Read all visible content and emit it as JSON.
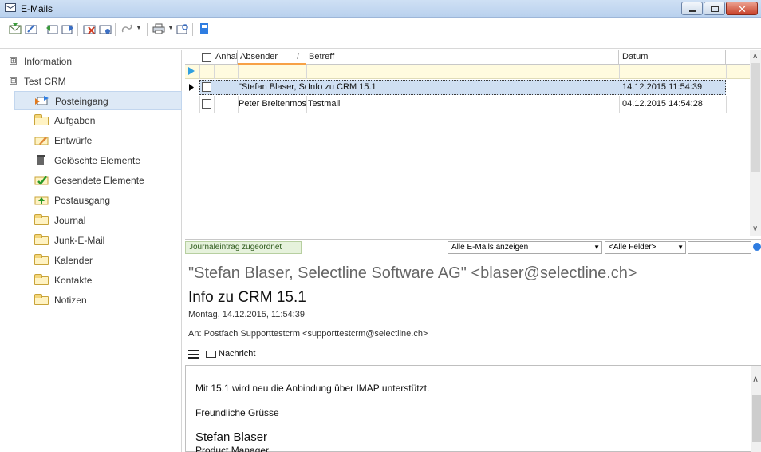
{
  "window": {
    "title": "E-Mails"
  },
  "nav": {
    "groups": [
      {
        "label": "Information",
        "expander": "⊞"
      },
      {
        "label": "Test CRM",
        "expander": "⊟"
      }
    ],
    "items": [
      {
        "label": "Posteingang",
        "icon": "inbox-icon"
      },
      {
        "label": "Aufgaben",
        "icon": "folder-icon"
      },
      {
        "label": "Entwürfe",
        "icon": "drafts-icon"
      },
      {
        "label": "Gelöschte Elemente",
        "icon": "trash-icon"
      },
      {
        "label": "Gesendete Elemente",
        "icon": "sent-icon"
      },
      {
        "label": "Postausgang",
        "icon": "outbox-icon"
      },
      {
        "label": "Journal",
        "icon": "folder-icon"
      },
      {
        "label": "Junk-E-Mail",
        "icon": "folder-icon"
      },
      {
        "label": "Kalender",
        "icon": "folder-icon"
      },
      {
        "label": "Kontakte",
        "icon": "folder-icon"
      },
      {
        "label": "Notizen",
        "icon": "folder-icon"
      }
    ]
  },
  "grid": {
    "columns": {
      "attach": "Anhai",
      "sender": "Absender",
      "sort_mark": "/",
      "subject": "Betreff",
      "date": "Datum"
    },
    "rows": [
      {
        "sender": "\"Stefan Blaser, Se",
        "subject": "Info zu CRM 15.1",
        "date": "14.12.2015 11:54:39"
      },
      {
        "sender": "Peter Breitenmose",
        "subject": "Testmail",
        "date": "04.12.2015 14:54:28"
      }
    ]
  },
  "status": {
    "journal": "Journaleintrag zugeordnet",
    "filter": "Alle E-Mails anzeigen",
    "fields": "<Alle Felder>"
  },
  "preview": {
    "from": "\"Stefan Blaser, Selectline Software AG\" <blaser@selectline.ch>",
    "subject": "Info zu CRM 15.1",
    "date": "Montag, 14.12.2015, 11:54:39",
    "to": "An: Postfach Supporttestcrm <supporttestcrm@selectline.ch>",
    "tab": "Nachricht",
    "body": [
      "Mit 15.1 wird neu die Anbindung über IMAP unterstützt.",
      "Freundliche Grüsse"
    ],
    "signature_name": "Stefan Blaser",
    "signature_role": "Product Manager"
  }
}
